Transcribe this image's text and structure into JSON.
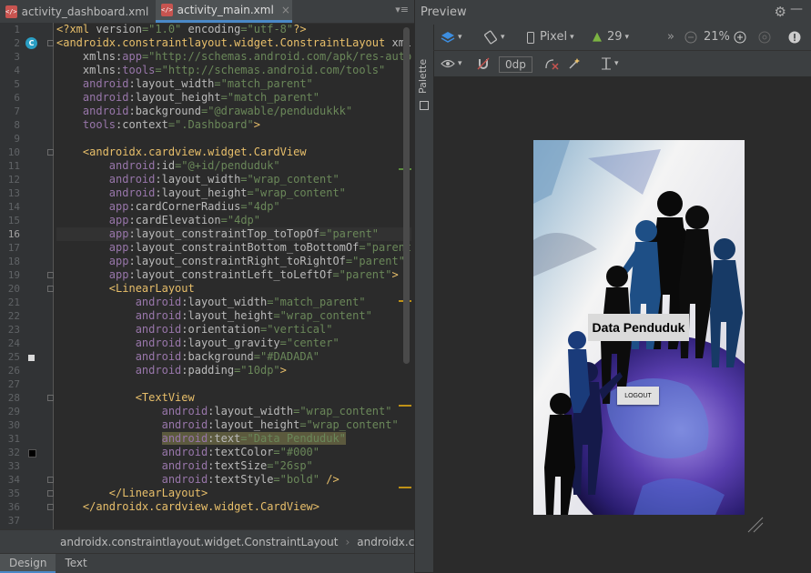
{
  "editor": {
    "tabs": [
      {
        "label": "activity_dashboard.xml",
        "active": false
      },
      {
        "label": "activity_main.xml",
        "active": true
      }
    ],
    "lines": [
      {
        "n": "1",
        "html": "<span class='t-tag'>&lt;?xml </span><span class='t-attr'>version</span><span class='t-str'>=\"1.0\"</span><span class='t-attr'> encoding</span><span class='t-str'>=\"utf-8\"</span><span class='t-tag'>?&gt;</span>"
      },
      {
        "n": "2",
        "html": "<span class='t-tag'>&lt;androidx.constraintlayout.widget.ConstraintLayout </span><span class='t-attr'>xmlns</span>"
      },
      {
        "n": "3",
        "html": "    <span class='t-attr'>xmlns:</span><span class='t-ns'>app</span><span class='t-str'>=\"http://schemas.android.com/apk/res-auto\"</span>"
      },
      {
        "n": "4",
        "html": "    <span class='t-attr'>xmlns:</span><span class='t-ns'>tools</span><span class='t-str'>=\"http://schemas.android.com/tools\"</span>"
      },
      {
        "n": "5",
        "html": "    <span class='t-ns'>android</span><span class='t-attr'>:layout_width</span><span class='t-str'>=\"match_parent\"</span>"
      },
      {
        "n": "6",
        "html": "    <span class='t-ns'>android</span><span class='t-attr'>:layout_height</span><span class='t-str'>=\"match_parent\"</span>"
      },
      {
        "n": "7",
        "html": "    <span class='t-ns'>android</span><span class='t-attr'>:background</span><span class='t-str'>=\"@drawable/pendudukkk\"</span>"
      },
      {
        "n": "8",
        "html": "    <span class='t-ns'>tools</span><span class='t-attr'>:context</span><span class='t-str'>=\".Dashboard\"</span><span class='t-tag'>&gt;</span>"
      },
      {
        "n": "9",
        "html": ""
      },
      {
        "n": "10",
        "html": "    <span class='t-tag'>&lt;androidx.cardview.widget.CardView</span>"
      },
      {
        "n": "11",
        "html": "        <span class='t-ns'>android</span><span class='t-attr'>:id</span><span class='t-str'>=\"@+id/penduduk\"</span>"
      },
      {
        "n": "12",
        "html": "        <span class='t-ns'>android</span><span class='t-attr'>:layout_width</span><span class='t-str'>=\"wrap_content\"</span>"
      },
      {
        "n": "13",
        "html": "        <span class='t-ns'>android</span><span class='t-attr'>:layout_height</span><span class='t-str'>=\"wrap_content\"</span>"
      },
      {
        "n": "14",
        "html": "        <span class='t-ns'>app</span><span class='t-attr'>:cardCornerRadius</span><span class='t-str'>=\"4dp\"</span>"
      },
      {
        "n": "15",
        "html": "        <span class='t-ns'>app</span><span class='t-attr'>:cardElevation</span><span class='t-str'>=\"4dp\"</span>"
      },
      {
        "n": "16",
        "html": "        <span class='t-ns'>app</span><span class='t-attr'>:layout_constraintTop_toTopOf</span><span class='t-str'>=\"parent\"</span>",
        "highlight": true
      },
      {
        "n": "17",
        "html": "        <span class='t-ns'>app</span><span class='t-attr'>:layout_constraintBottom_toBottomOf</span><span class='t-str'>=\"parent\"</span>"
      },
      {
        "n": "18",
        "html": "        <span class='t-ns'>app</span><span class='t-attr'>:layout_constraintRight_toRightOf</span><span class='t-str'>=\"parent\"</span>"
      },
      {
        "n": "19",
        "html": "        <span class='t-ns'>app</span><span class='t-attr'>:layout_constraintLeft_toLeftOf</span><span class='t-str'>=\"parent\"</span><span class='t-tag'>&gt;</span>"
      },
      {
        "n": "20",
        "html": "        <span class='t-tag'>&lt;LinearLayout</span>"
      },
      {
        "n": "21",
        "html": "            <span class='t-ns'>android</span><span class='t-attr'>:layout_width</span><span class='t-str'>=\"match_parent\"</span>"
      },
      {
        "n": "22",
        "html": "            <span class='t-ns'>android</span><span class='t-attr'>:layout_height</span><span class='t-str'>=\"wrap_content\"</span>"
      },
      {
        "n": "23",
        "html": "            <span class='t-ns'>android</span><span class='t-attr'>:orientation</span><span class='t-str'>=\"vertical\"</span>"
      },
      {
        "n": "24",
        "html": "            <span class='t-ns'>android</span><span class='t-attr'>:layout_gravity</span><span class='t-str'>=\"center\"</span>"
      },
      {
        "n": "25",
        "html": "            <span class='t-ns'>android</span><span class='t-attr'>:background</span><span class='t-str'>=\"#DADADA\"</span>"
      },
      {
        "n": "26",
        "html": "            <span class='t-ns'>android</span><span class='t-attr'>:padding</span><span class='t-str'>=\"10dp\"</span><span class='t-tag'>&gt;</span>"
      },
      {
        "n": "27",
        "html": ""
      },
      {
        "n": "28",
        "html": "            <span class='t-tag'>&lt;TextView</span>"
      },
      {
        "n": "29",
        "html": "                <span class='t-ns'>android</span><span class='t-attr'>:layout_width</span><span class='t-str'>=\"wrap_content\"</span>"
      },
      {
        "n": "30",
        "html": "                <span class='t-ns'>android</span><span class='t-attr'>:layout_height</span><span class='t-str'>=\"wrap_content\"</span>"
      },
      {
        "n": "31",
        "html": "                <span class='sel'><span class='t-ns'>android</span><span class='t-attr'>:text</span><span class='t-str'>=\"Data Penduduk\"</span></span>"
      },
      {
        "n": "32",
        "html": "                <span class='t-ns'>android</span><span class='t-attr'>:textColor</span><span class='t-str'>=\"#000\"</span>"
      },
      {
        "n": "33",
        "html": "                <span class='t-ns'>android</span><span class='t-attr'>:textSize</span><span class='t-str'>=\"26sp\"</span>"
      },
      {
        "n": "34",
        "html": "                <span class='t-ns'>android</span><span class='t-attr'>:textStyle</span><span class='t-str'>=\"bold\"</span><span class='t-tag'> /&gt;</span>"
      },
      {
        "n": "35",
        "html": "        <span class='t-tag'>&lt;/LinearLayout&gt;</span>"
      },
      {
        "n": "36",
        "html": "    <span class='t-tag'>&lt;/androidx.cardview.widget.CardView&gt;</span>"
      },
      {
        "n": "37",
        "html": ""
      }
    ],
    "breadcrumb": [
      "androidx.constraintlayout.widget.ConstraintLayout",
      "androidx.card"
    ],
    "bottom_tabs": [
      "Design",
      "Text"
    ]
  },
  "preview": {
    "title": "Preview",
    "palette_label": "Palette",
    "device": "Pixel",
    "api": "29",
    "zoom": "21%",
    "margin": "0dp",
    "card_text": "Data Penduduk",
    "button_text": "LOGOUT"
  },
  "colors": {
    "accent": "#4a88c7",
    "card_bg": "#DADADA"
  }
}
